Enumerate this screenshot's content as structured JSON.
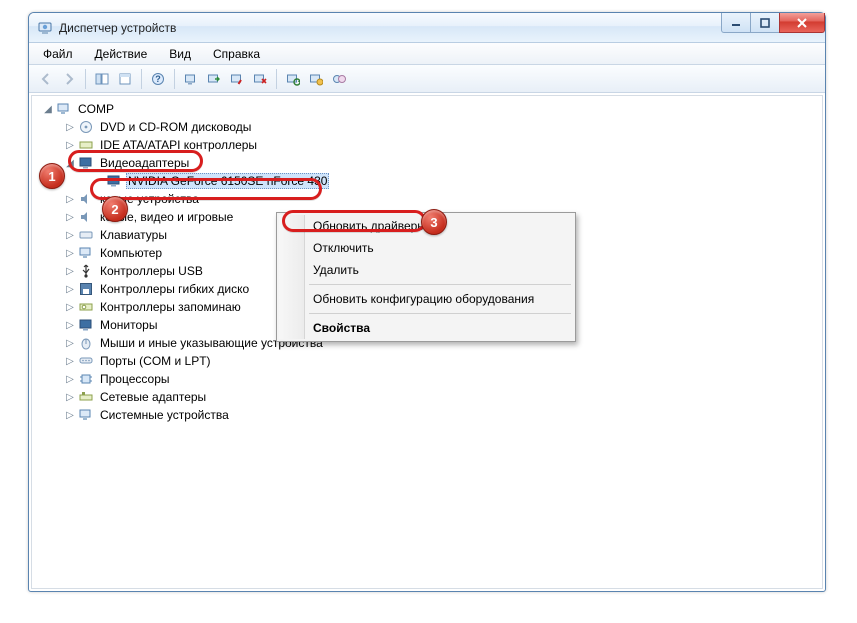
{
  "title": "Диспетчер устройств",
  "menus": {
    "file": "Файл",
    "action": "Действие",
    "view": "Вид",
    "help": "Справка"
  },
  "tree": {
    "root": "COMP",
    "dvd": "DVD и CD-ROM дисководы",
    "ide": "IDE ATA/ATAPI контроллеры",
    "video": "Видеоадаптеры",
    "video_device": "NVIDIA GeForce 6150SE nForce 430",
    "sound_partial": "ковые устройства",
    "av_partial": "ковые, видео и игровые",
    "keyboards": "Клавиатуры",
    "computer": "Компьютер",
    "usb": "Контроллеры USB",
    "floppy": "Контроллеры гибких диско",
    "storage": "Контроллеры запоминаю",
    "monitors": "Мониторы",
    "mice": "Мыши и иные указывающие устройства",
    "ports": "Порты (COM и LPT)",
    "cpu": "Процессоры",
    "net": "Сетевые адаптеры",
    "system": "Системные устройства"
  },
  "context_menu": {
    "update": "Обновить драйверы...",
    "disable": "Отключить",
    "delete": "Удалить",
    "refresh": "Обновить конфигурацию оборудования",
    "properties": "Свойства"
  },
  "badges": {
    "one": "1",
    "two": "2",
    "three": "3"
  }
}
